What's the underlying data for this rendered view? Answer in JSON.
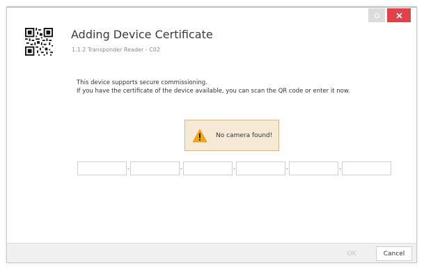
{
  "dialog": {
    "title": "Adding Device Certificate",
    "subtitle": "1.1.2 Transponder Reader - C02",
    "description_line1": "This device supports secure commissioning.",
    "description_line2": "If you have the certificate of the device available, you can scan the QR code or enter it now.",
    "qr_icon": "qr-code-icon"
  },
  "titlebar": {
    "restore_icon": "restore-icon",
    "close_icon": "close-icon",
    "close_color": "#e0424a"
  },
  "warning": {
    "icon": "warning-triangle-icon",
    "text": "No camera found!",
    "background": "#f6ead7",
    "icon_color": "#f2a516"
  },
  "certificate": {
    "fields": [
      "",
      "",
      "",
      "",
      "",
      ""
    ],
    "separator": "-"
  },
  "footer": {
    "ok_label": "OK",
    "cancel_label": "Cancel"
  }
}
